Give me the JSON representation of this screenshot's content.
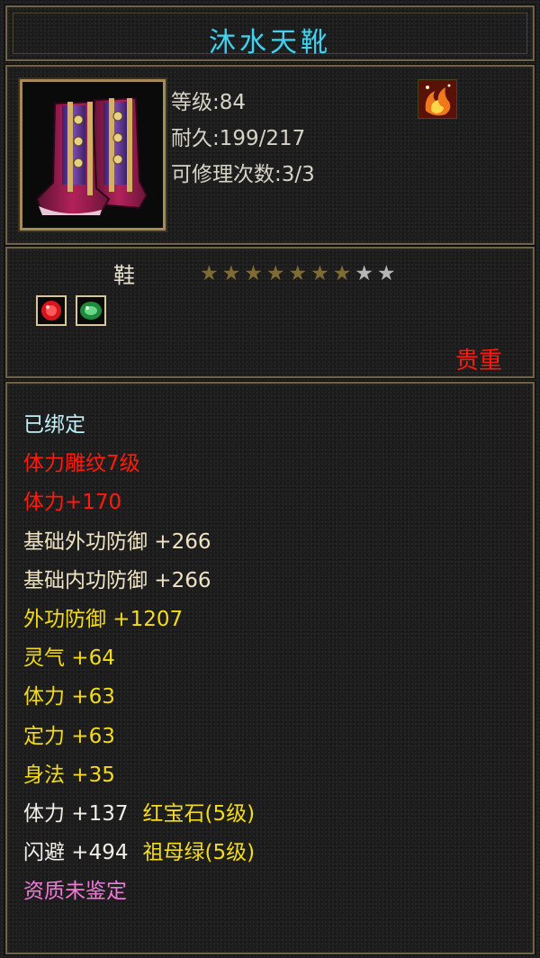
{
  "item": {
    "name": "沐水天靴",
    "level": "等级:84",
    "durability": "耐久:199/217",
    "repair_count": "可修理次数:3/3",
    "icon": "boots-icon",
    "badge_icon": "flame-badge-icon",
    "type": "鞋",
    "stars_filled": 7,
    "stars_total": 9,
    "rarity": "贵重",
    "gems": [
      {
        "name": "ruby-gem-icon",
        "color": "#d8141c"
      },
      {
        "name": "emerald-gem-icon",
        "color": "#2fa84a"
      }
    ]
  },
  "stats": [
    {
      "text": "已绑定",
      "color": "cyan"
    },
    {
      "text": "体力雕纹7级",
      "color": "red"
    },
    {
      "text": "体力+170",
      "color": "red"
    },
    {
      "text": "基础外功防御 +266",
      "color": "tan"
    },
    {
      "text": "基础内功防御 +266",
      "color": "tan"
    },
    {
      "text": "外功防御 +1207",
      "color": "yellow"
    },
    {
      "text": "灵气 +64",
      "color": "yellow"
    },
    {
      "text": "体力 +63",
      "color": "yellow"
    },
    {
      "text": "定力 +63",
      "color": "yellow"
    },
    {
      "text": "身法 +35",
      "color": "yellow"
    },
    {
      "text": "体力 +137",
      "color": "white",
      "suffix": "红宝石(5级)"
    },
    {
      "text": "闪避 +494",
      "color": "white",
      "suffix": "祖母绿(5级)"
    },
    {
      "text": "资质未鉴定",
      "color": "pink"
    }
  ],
  "colors": {
    "title": "#46d0ea",
    "rarity": "#ff1a0c",
    "gem_suffix": "#f4dc18",
    "frame": "#6e624a"
  }
}
